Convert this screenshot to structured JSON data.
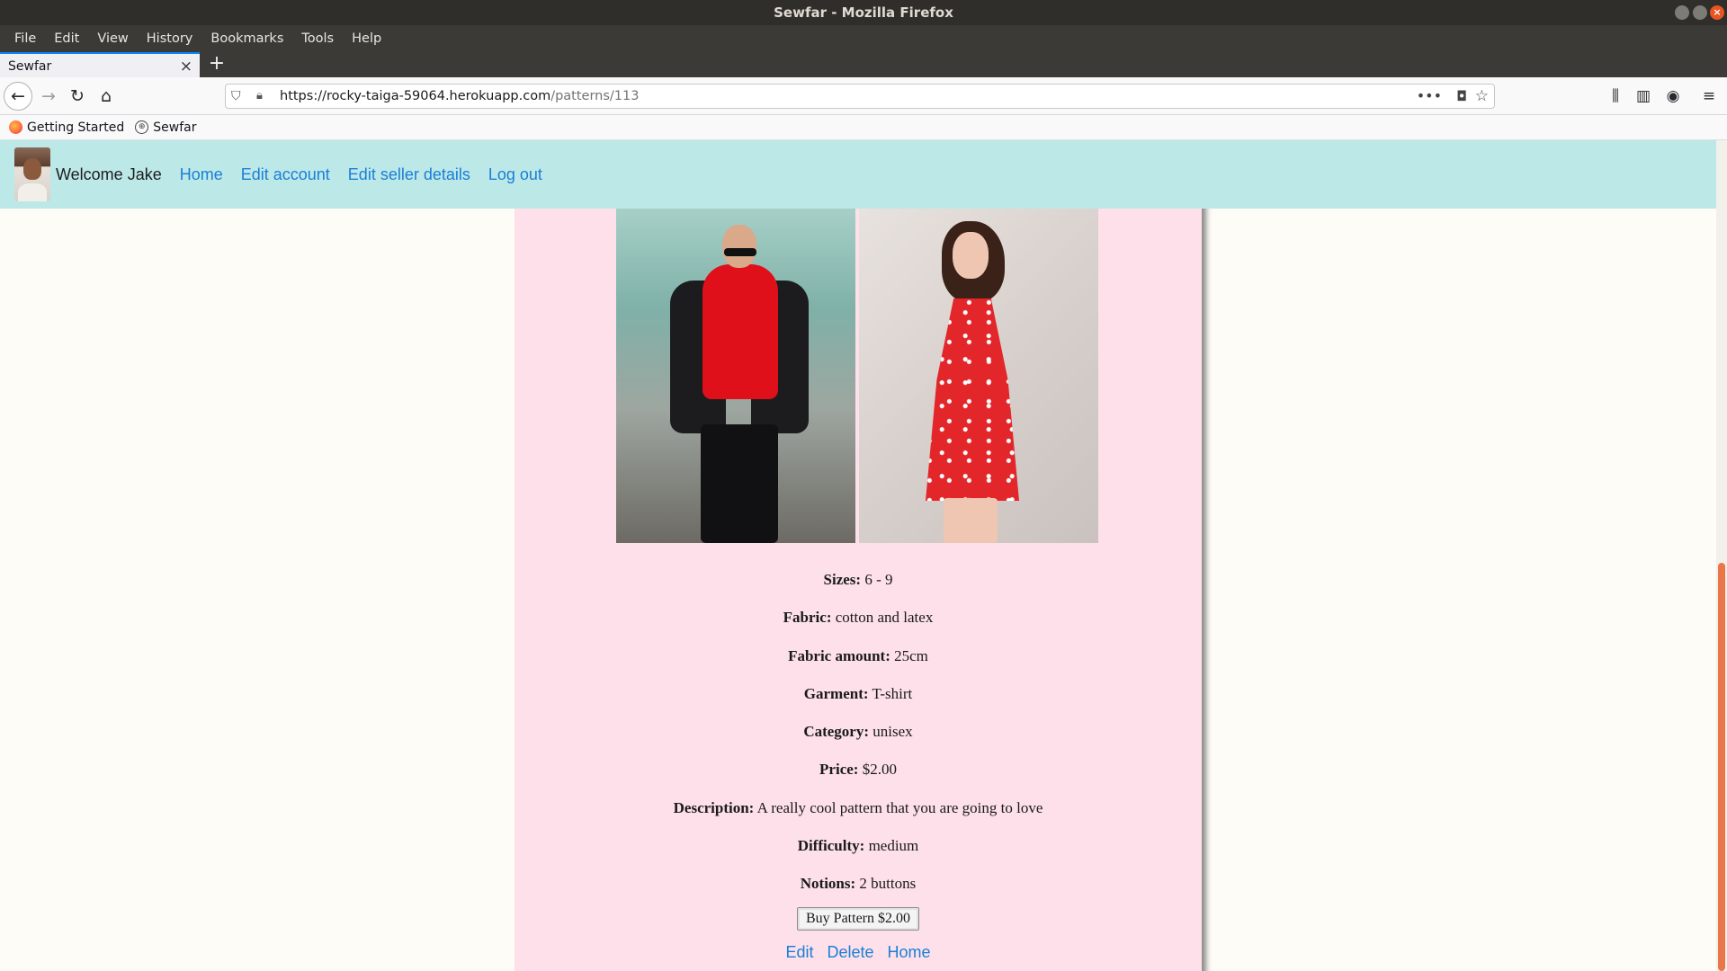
{
  "window": {
    "title": "Sewfar - Mozilla Firefox"
  },
  "menubar": [
    "File",
    "Edit",
    "View",
    "History",
    "Bookmarks",
    "Tools",
    "Help"
  ],
  "tab": {
    "label": "Sewfar"
  },
  "url": {
    "host": "https://rocky-taiga-59064.herokuapp.com",
    "path": "/patterns/113"
  },
  "bookmarks": [
    {
      "label": "Getting Started",
      "icon": "firefox-icon"
    },
    {
      "label": "Sewfar",
      "icon": "globe-icon"
    }
  ],
  "site_nav": {
    "welcome": "Welcome Jake",
    "links": [
      "Home",
      "Edit account",
      "Edit seller details",
      "Log out"
    ]
  },
  "pattern": {
    "details": [
      {
        "label": "Sizes:",
        "value": "6 - 9"
      },
      {
        "label": "Fabric:",
        "value": "cotton and latex"
      },
      {
        "label": "Fabric amount:",
        "value": "25cm"
      },
      {
        "label": "Garment:",
        "value": "T-shirt"
      },
      {
        "label": "Category:",
        "value": "unisex"
      },
      {
        "label": "Price:",
        "value": "$2.00"
      },
      {
        "label": "Description:",
        "value": "A really cool pattern that you are going to love"
      },
      {
        "label": "Difficulty:",
        "value": "medium"
      },
      {
        "label": "Notions:",
        "value": "2 buttons"
      }
    ],
    "buy_button": "Buy Pattern $2.00",
    "actions": [
      "Edit",
      "Delete",
      "Home"
    ]
  },
  "colors": {
    "nav_bg": "#bde8e8",
    "card_bg": "#fde0e9",
    "link": "#1a7fd6"
  }
}
